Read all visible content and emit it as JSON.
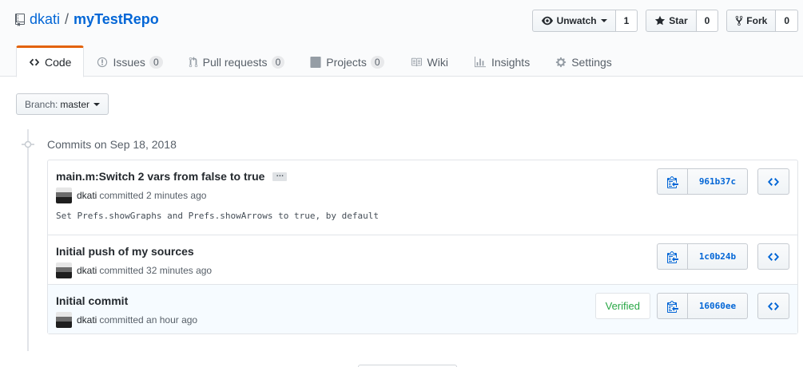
{
  "repo": {
    "owner": "dkati",
    "separator": "/",
    "name": "myTestRepo"
  },
  "actions": {
    "watch": {
      "label": "Unwatch",
      "count": "1"
    },
    "star": {
      "label": "Star",
      "count": "0"
    },
    "fork": {
      "label": "Fork",
      "count": "0"
    }
  },
  "tabs": [
    {
      "label": "Code",
      "icon": "code-icon"
    },
    {
      "label": "Issues",
      "count": "0",
      "icon": "issue-icon"
    },
    {
      "label": "Pull requests",
      "count": "0",
      "icon": "pull-request-icon"
    },
    {
      "label": "Projects",
      "count": "0",
      "icon": "project-icon"
    },
    {
      "label": "Wiki",
      "icon": "book-icon"
    },
    {
      "label": "Insights",
      "icon": "graph-icon"
    },
    {
      "label": "Settings",
      "icon": "gear-icon"
    }
  ],
  "branch": {
    "prefix": "Branch:",
    "name": "master"
  },
  "commits_header": "Commits on Sep 18, 2018",
  "commits": [
    {
      "message": "main.m:Switch 2 vars from false to true",
      "ellipsis": "…",
      "author": "dkati",
      "time": "committed 2 minutes ago",
      "description": "Set Prefs.showGraphs and Prefs.showArrows to true, by default",
      "sha": "961b37c"
    },
    {
      "message": "Initial push of my sources",
      "author": "dkati",
      "time": "committed 32 minutes ago",
      "sha": "1c0b24b"
    },
    {
      "message": "Initial commit",
      "author": "dkati",
      "time": "committed an hour ago",
      "badge": "Verified",
      "sha": "16060ee"
    }
  ],
  "colors": {
    "link": "#0366d6",
    "tab_accent": "#e36209",
    "verified": "#28a745"
  }
}
